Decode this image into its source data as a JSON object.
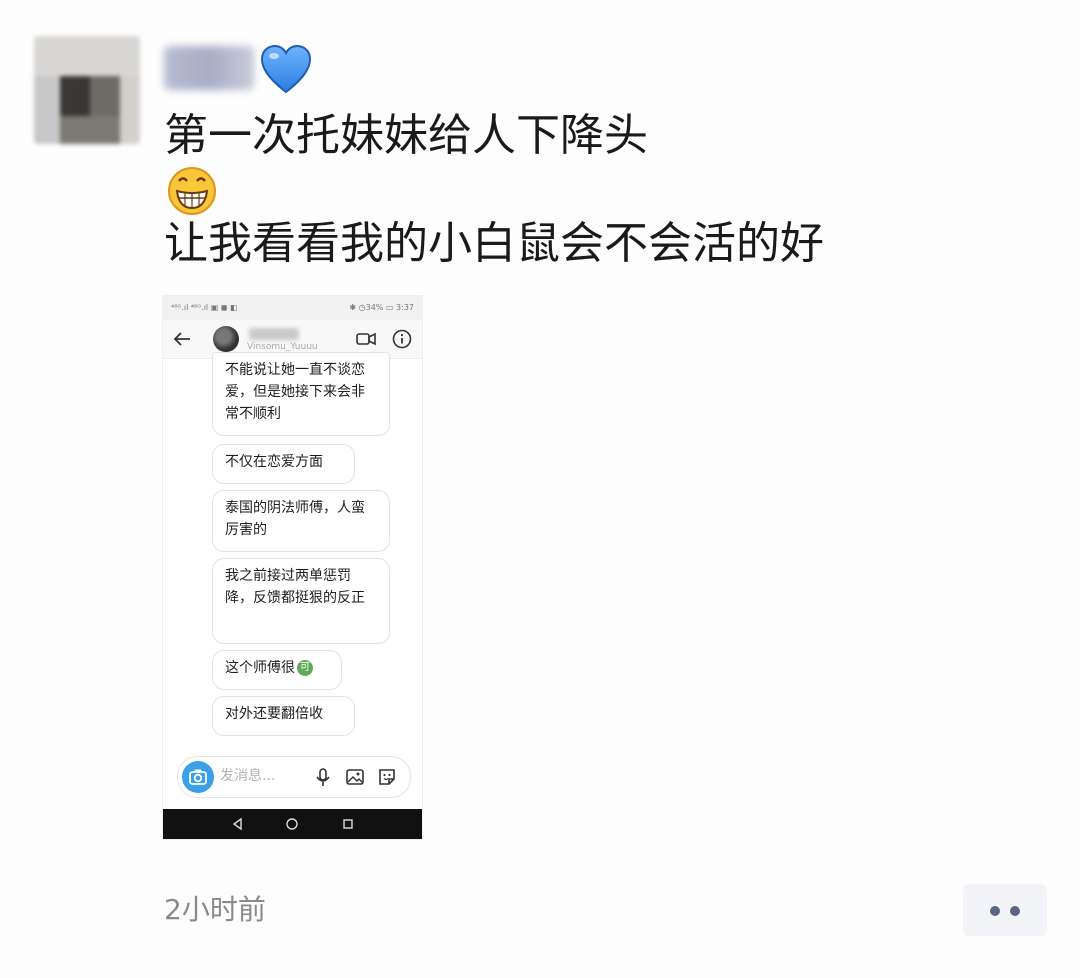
{
  "post": {
    "line1": "第一次托妹妹给人下降头",
    "line3": "让我看看我的小白鼠会不会活的好",
    "time": "2小时前"
  },
  "icons": {
    "heart": "blue-heart-icon",
    "emoji": "grinning-face-icon",
    "more": "more-dots-icon"
  },
  "screenshot": {
    "status_left": "⁴⁶ᴳ.ıl ⁴⁶ᴳ.ıl ▣ ◼ ◧",
    "status_right": "✱ ◷34% ▭ 3:37",
    "contact_handle": "Vinsomu_Yuuuu",
    "messages": [
      "不能说让她一直不谈恋爱，但是她接下来会非常不顺利",
      "不仅在恋爱方面",
      "泰国的阴法师傅，人蛮厉害的",
      "我之前接过两单惩罚降，反馈都挺狠的反正",
      "这个师傅很",
      "对外还要翻倍收"
    ],
    "ke_badge": "可",
    "composer_placeholder": "发消息..."
  },
  "colors": {
    "accent_blue": "#3aa0e8",
    "more_dots": "#5a6684",
    "heart_blue": "#3d8fe8"
  }
}
